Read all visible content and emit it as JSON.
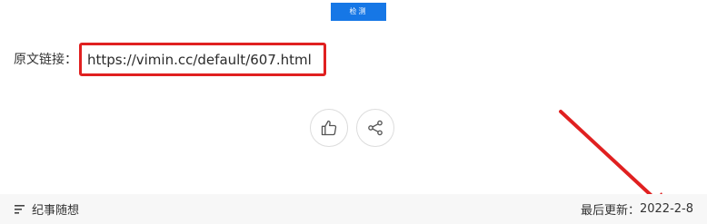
{
  "toolbar": {
    "detect_label": "检测"
  },
  "source": {
    "label": "原文链接：",
    "url": "https://vimin.cc/default/607.html"
  },
  "actions": {
    "like_icon": "thumbs-up-icon",
    "share_icon": "share-icon"
  },
  "footer": {
    "category_icon": "list-icon",
    "category": "纪事随想",
    "updated_label": "最后更新：",
    "updated_date": "2022-2-8"
  },
  "colors": {
    "accent_blue": "#1677e6",
    "highlight_red": "#e02020",
    "footer_bg": "#f7f7f7"
  }
}
